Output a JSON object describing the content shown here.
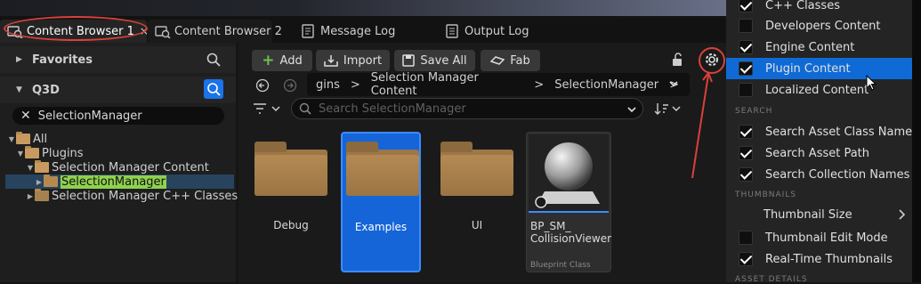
{
  "tabs": {
    "content_browser_1": "Content Browser 1",
    "content_browser_2": "Content Browser 2",
    "message_log": "Message Log",
    "output_log": "Output Log",
    "close": "×"
  },
  "sidebar": {
    "favorites": "Favorites",
    "q3d": "Q3D",
    "path_filter": "SelectionManager",
    "tree": {
      "all": "All",
      "plugins": "Plugins",
      "selection_manager_content": "Selection Manager Content",
      "selection_manager": "SelectionManager",
      "selection_manager_cpp": "Selection Manager C++ Classes"
    }
  },
  "toolbar": {
    "add": "Add",
    "import": "Import",
    "save_all": "Save All",
    "fab": "Fab"
  },
  "breadcrumb": {
    "truncated": "gins",
    "sep": ">",
    "content": "Selection Manager Content",
    "folder": "SelectionManager"
  },
  "search": {
    "placeholder": "Search SelectionManager"
  },
  "assets": {
    "debug": "Debug",
    "examples": "Examples",
    "ui": "UI",
    "bp_line1": "BP_SM_",
    "bp_line2": "CollisionViewer",
    "bp_type": "Blueprint Class"
  },
  "settings_menu": {
    "cpp_classes": "C++ Classes",
    "developers_content": "Developers Content",
    "engine_content": "Engine Content",
    "plugin_content": "Plugin Content",
    "localized_content": "Localized Content",
    "search_header": "SEARCH",
    "search_asset_class_names": "Search Asset Class Names",
    "search_asset_path": "Search Asset Path",
    "search_collection_names": "Search Collection Names",
    "thumbnails_header": "THUMBNAILS",
    "thumbnail_size": "Thumbnail Size",
    "thumbnail_edit_mode": "Thumbnail Edit Mode",
    "realtime_thumbnails": "Real-Time Thumbnails",
    "asset_details_header": "ASSET DETAILS"
  },
  "colors": {
    "selection_blue": "#0f6ad6",
    "annotation_red": "#d9413a",
    "folder": "#b7894f",
    "highlight_green": "#8fd14f"
  }
}
